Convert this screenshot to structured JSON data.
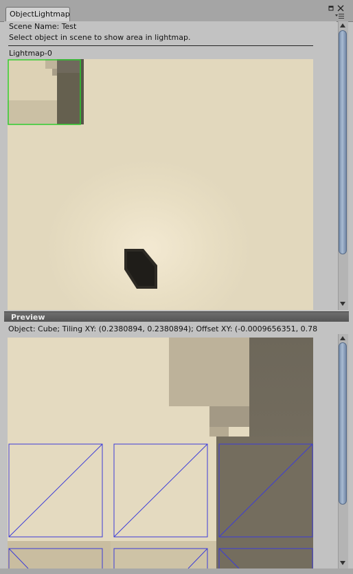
{
  "window": {
    "tab_title": "ObjectLightmap",
    "icons": [
      "restore-icon",
      "close-icon",
      "menu-icon"
    ]
  },
  "header": {
    "scene_label": "Scene Name: Test",
    "instruction": "Select object in scene to show area in lightmap.",
    "lightmap_label": "Lightmap-0"
  },
  "preview": {
    "header_label": "Preview",
    "object_info": "Object: Cube; Tiling XY: (0.2380894, 0.2380894); Offset XY: (-0.0009656351, 0.78"
  },
  "colors": {
    "lightmap_background": "#e2d8bd",
    "selection_outline": "#2ecc2e",
    "uv_wireframe": "#3b3bd9",
    "scrollbar_thumb": "#8fa3c0"
  }
}
